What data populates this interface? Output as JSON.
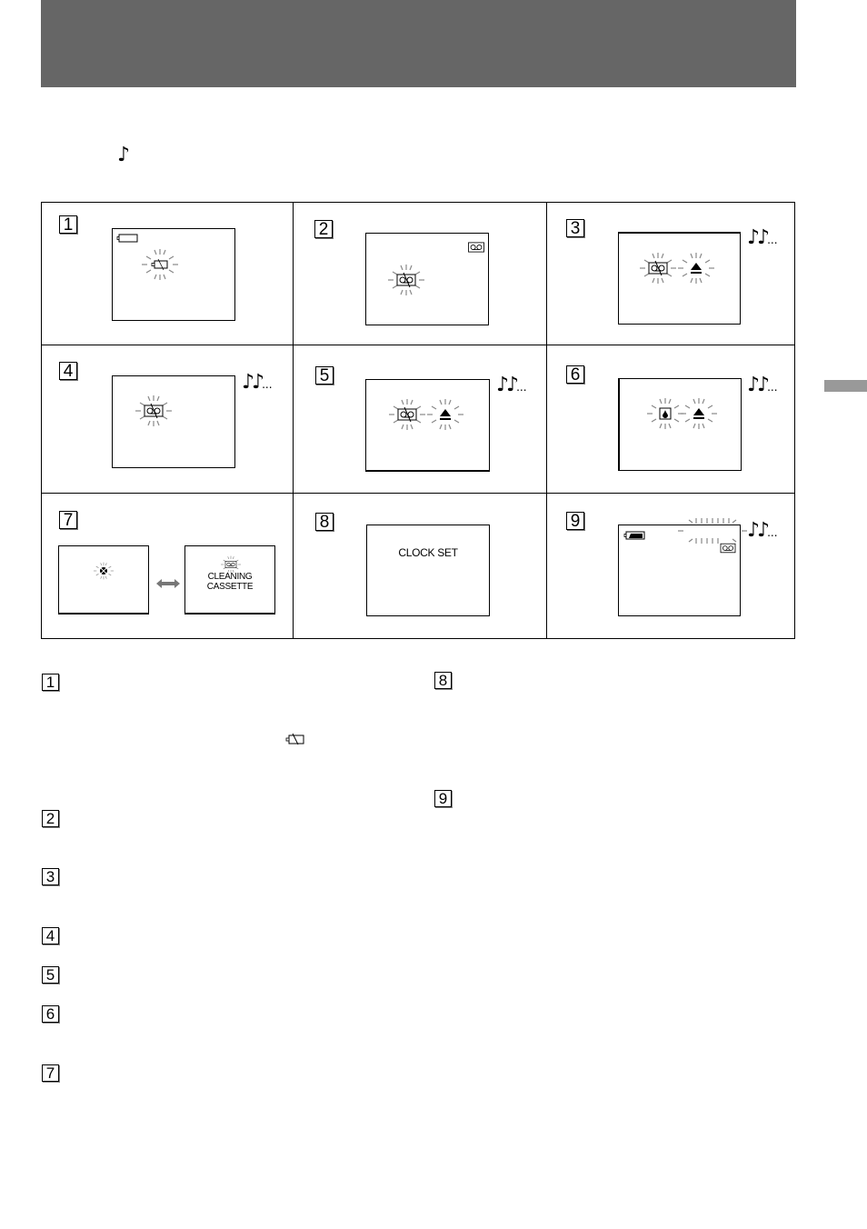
{
  "page": {
    "header_bar_color": "#666666",
    "side_tab_color": "#999999",
    "intro_symbol": "♪"
  },
  "panels": [
    {
      "number": "1",
      "screen_icons": [
        "battery-icon",
        "blinking-battery-empty-icon"
      ],
      "beep": false
    },
    {
      "number": "2",
      "screen_icons": [
        "cassette-icon",
        "blinking-no-cassette-icon"
      ],
      "beep": false
    },
    {
      "number": "3",
      "screen_icons": [
        "blinking-no-cassette-icon",
        "blinking-eject-icon"
      ],
      "beep": true
    },
    {
      "number": "4",
      "screen_icons": [
        "blinking-no-cassette-icon"
      ],
      "beep": true
    },
    {
      "number": "5",
      "screen_icons": [
        "blinking-no-cassette-icon",
        "blinking-eject-icon"
      ],
      "beep": true
    },
    {
      "number": "6",
      "screen_icons": [
        "blinking-condensation-icon",
        "blinking-eject-icon"
      ],
      "beep": true
    },
    {
      "number": "7",
      "screen_icons": [
        "blinking-head-dirty-icon",
        "alternate-arrow-icon",
        "blinking-cassette-icon"
      ],
      "screen_text": [
        "CLEANING",
        "CASSETTE"
      ],
      "beep": false
    },
    {
      "number": "8",
      "screen_text": [
        "CLOCK SET"
      ],
      "beep": false
    },
    {
      "number": "9",
      "screen_icons": [
        "battery-full-icon",
        "blinking-tape-counter",
        "cassette-icon"
      ],
      "beep": true
    }
  ],
  "beep_symbol": "♪♪",
  "beep_dots": "...",
  "notes": [
    {
      "number": "1",
      "inline_icon": "battery-empty-icon"
    },
    {
      "number": "2"
    },
    {
      "number": "3"
    },
    {
      "number": "4"
    },
    {
      "number": "5"
    },
    {
      "number": "6"
    },
    {
      "number": "7"
    },
    {
      "number": "8"
    },
    {
      "number": "9"
    }
  ]
}
